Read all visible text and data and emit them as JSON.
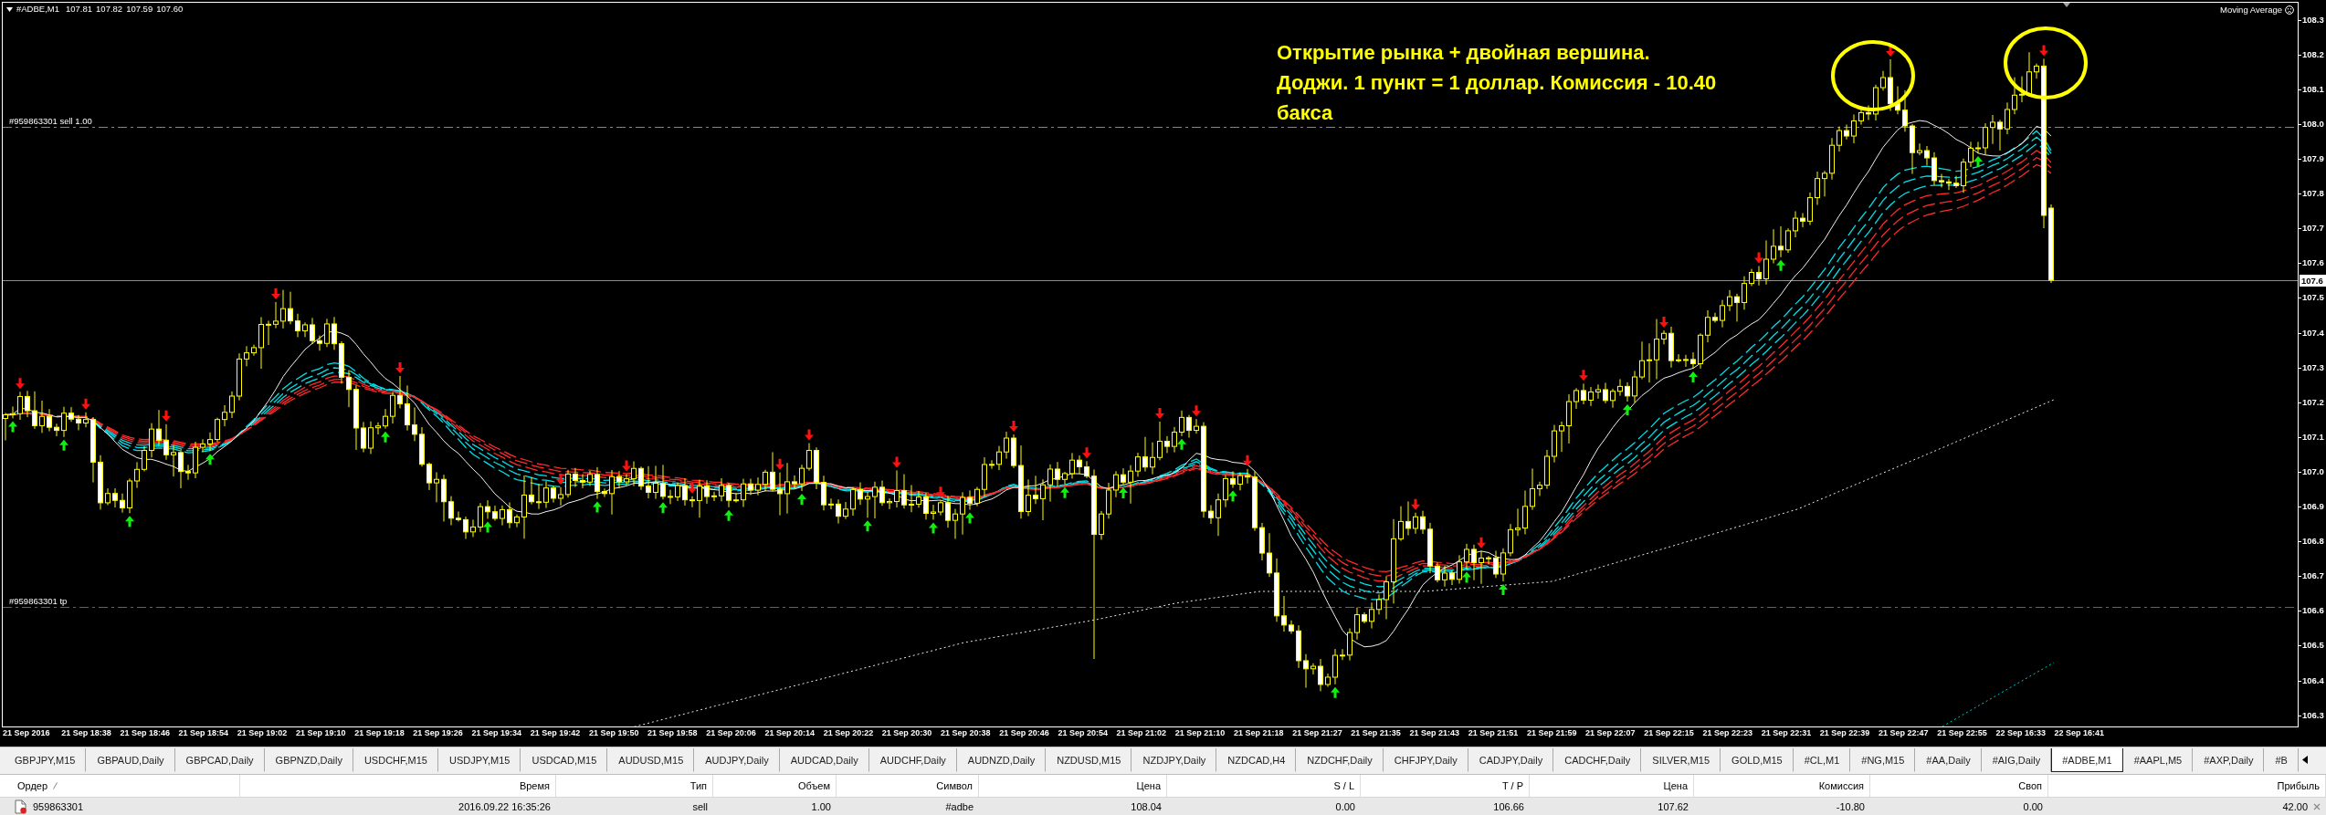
{
  "chart": {
    "symbol": "#ADBE,M1",
    "ohlc": [
      "107.81",
      "107.82",
      "107.59",
      "107.60"
    ],
    "expert": {
      "name": "Moving Average",
      "trading_enabled": false
    },
    "order_lines": [
      {
        "kind": "sell",
        "label": "#959863301 sell 1.00"
      },
      {
        "kind": "tp",
        "label": "#959863301 tp"
      }
    ],
    "annotation": [
      "Открытие рынка + двойная вершина.",
      "Доджи. 1 пункт = 1 доллар. Комиссия - 10.40",
      "бакса"
    ],
    "price_axis": {
      "labels": [
        "108.3",
        "108.2",
        "108.1",
        "108.0",
        "107.9",
        "107.8",
        "107.7",
        "107.6",
        "107.5",
        "107.4",
        "107.3",
        "107.2",
        "107.1",
        "107.0",
        "106.9",
        "106.8",
        "106.7",
        "106.6",
        "106.5",
        "106.4",
        "106.3"
      ],
      "current_price": "107.6"
    },
    "time_axis": [
      "21 Sep 2016",
      "21 Sep 18:38",
      "21 Sep 18:46",
      "21 Sep 18:54",
      "21 Sep 19:02",
      "21 Sep 19:10",
      "21 Sep 19:18",
      "21 Sep 19:26",
      "21 Sep 19:34",
      "21 Sep 19:42",
      "21 Sep 19:50",
      "21 Sep 19:58",
      "21 Sep 20:06",
      "21 Sep 20:14",
      "21 Sep 20:22",
      "21 Sep 20:30",
      "21 Sep 20:38",
      "21 Sep 20:46",
      "21 Sep 20:54",
      "21 Sep 21:02",
      "21 Sep 21:10",
      "21 Sep 21:18",
      "21 Sep 21:27",
      "21 Sep 21:35",
      "21 Sep 21:43",
      "21 Sep 21:51",
      "21 Sep 21:59",
      "21 Sep 22:07",
      "21 Sep 22:15",
      "21 Sep 22:23",
      "21 Sep 22:31",
      "21 Sep 22:39",
      "21 Sep 22:47",
      "21 Sep 22:55",
      "22 Sep 16:33",
      "22 Sep 16:41"
    ]
  },
  "symbol_tabs": [
    {
      "label": "GBPJPY,M15",
      "selected": false
    },
    {
      "label": "GBPAUD,Daily",
      "selected": false
    },
    {
      "label": "GBPCAD,Daily",
      "selected": false
    },
    {
      "label": "GBPNZD,Daily",
      "selected": false
    },
    {
      "label": "USDCHF,M15",
      "selected": false
    },
    {
      "label": "USDJPY,M15",
      "selected": false
    },
    {
      "label": "USDCAD,M15",
      "selected": false
    },
    {
      "label": "AUDUSD,M15",
      "selected": false
    },
    {
      "label": "AUDJPY,Daily",
      "selected": false
    },
    {
      "label": "AUDCAD,Daily",
      "selected": false
    },
    {
      "label": "AUDCHF,Daily",
      "selected": false
    },
    {
      "label": "AUDNZD,Daily",
      "selected": false
    },
    {
      "label": "NZDUSD,M15",
      "selected": false
    },
    {
      "label": "NZDJPY,Daily",
      "selected": false
    },
    {
      "label": "NZDCAD,H4",
      "selected": false
    },
    {
      "label": "NZDCHF,Daily",
      "selected": false
    },
    {
      "label": "CHFJPY,Daily",
      "selected": false
    },
    {
      "label": "CADJPY,Daily",
      "selected": false
    },
    {
      "label": "CADCHF,Daily",
      "selected": false
    },
    {
      "label": "SILVER,M15",
      "selected": false
    },
    {
      "label": "GOLD,M15",
      "selected": false
    },
    {
      "label": "#CL,M1",
      "selected": false
    },
    {
      "label": "#NG,M15",
      "selected": false
    },
    {
      "label": "#AA,Daily",
      "selected": false
    },
    {
      "label": "#AIG,Daily",
      "selected": false
    },
    {
      "label": "#ADBE,M1",
      "selected": true
    },
    {
      "label": "#AAPL,M5",
      "selected": false
    },
    {
      "label": "#AXP,Daily",
      "selected": false
    },
    {
      "label": "#B",
      "selected": false
    }
  ],
  "trade_table": {
    "columns": [
      "Ордер",
      "Время",
      "Тип",
      "Объем",
      "Символ",
      "Цена",
      "S / L",
      "T / P",
      "Цена",
      "Комиссия",
      "Своп",
      "Прибыль"
    ],
    "rows": [
      {
        "cells": [
          "959863301",
          "2016.09.22 16:35:26",
          "sell",
          "1.00",
          "#adbe",
          "108.04",
          "0.00",
          "106.66",
          "107.62",
          "-10.80",
          "0.00",
          "42.00"
        ]
      }
    ]
  }
}
